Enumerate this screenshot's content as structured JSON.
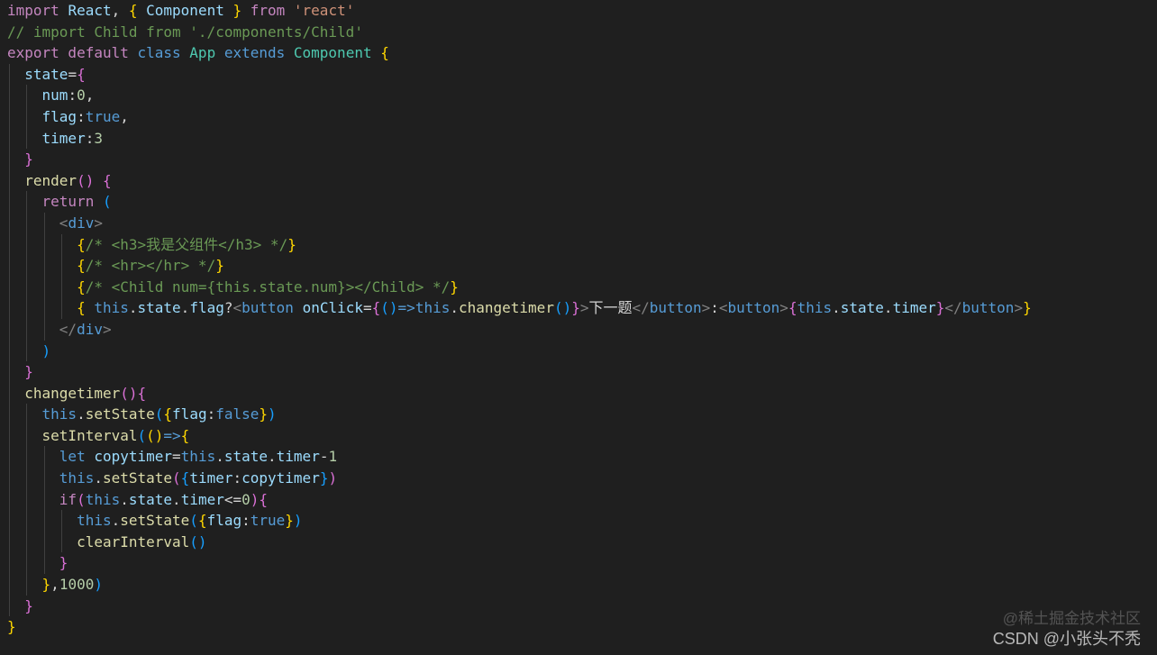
{
  "editor": {
    "background": "#1f1f1f",
    "lines": [
      [
        [
          "kw",
          "import "
        ],
        [
          "id",
          "React"
        ],
        [
          "pn",
          ", "
        ],
        [
          "b1",
          "{ "
        ],
        [
          "id",
          "Component"
        ],
        [
          "b1",
          " }"
        ],
        [
          "kw",
          " from "
        ],
        [
          "str",
          "'react'"
        ]
      ],
      [
        [
          "cm",
          "// import Child from './components/Child'"
        ]
      ],
      [
        [
          "kw",
          "export default "
        ],
        [
          "st",
          "class "
        ],
        [
          "cl",
          "App "
        ],
        [
          "st",
          "extends "
        ],
        [
          "cl",
          "Component "
        ],
        [
          "b1",
          "{"
        ]
      ],
      [
        [
          "id",
          "  state"
        ],
        [
          "pn",
          "="
        ],
        [
          "b2",
          "{"
        ]
      ],
      [
        [
          "id",
          "    num"
        ],
        [
          "pn",
          ":"
        ],
        [
          "num",
          "0"
        ],
        [
          "pn",
          ","
        ]
      ],
      [
        [
          "id",
          "    flag"
        ],
        [
          "pn",
          ":"
        ],
        [
          "st",
          "true"
        ],
        [
          "pn",
          ","
        ]
      ],
      [
        [
          "id",
          "    timer"
        ],
        [
          "pn",
          ":"
        ],
        [
          "num",
          "3"
        ]
      ],
      [
        [
          "b2",
          "  }"
        ]
      ],
      [
        [
          "fn",
          "  render"
        ],
        [
          "b2",
          "()"
        ],
        [
          "pn",
          " "
        ],
        [
          "b2",
          "{"
        ]
      ],
      [
        [
          "kw",
          "    return "
        ],
        [
          "b3",
          "("
        ]
      ],
      [
        [
          "tg",
          "      <"
        ],
        [
          "st",
          "div"
        ],
        [
          "tg",
          ">"
        ]
      ],
      [
        [
          "b1",
          "        {"
        ],
        [
          "cm",
          "/* <h3>我是父组件</h3> */"
        ],
        [
          "b1",
          "}"
        ]
      ],
      [
        [
          "b1",
          "        {"
        ],
        [
          "cm",
          "/* <hr></hr> */"
        ],
        [
          "b1",
          "}"
        ]
      ],
      [
        [
          "b1",
          "        {"
        ],
        [
          "cm",
          "/* <Child num={this.state.num}></Child> */"
        ],
        [
          "b1",
          "}"
        ]
      ],
      [
        [
          "b1",
          "        { "
        ],
        [
          "st",
          "this"
        ],
        [
          "pn",
          "."
        ],
        [
          "id",
          "state"
        ],
        [
          "pn",
          "."
        ],
        [
          "id",
          "flag"
        ],
        [
          "pn",
          "?"
        ],
        [
          "tg",
          "<"
        ],
        [
          "st",
          "button "
        ],
        [
          "id",
          "onClick"
        ],
        [
          "pn",
          "="
        ],
        [
          "b2",
          "{"
        ],
        [
          "b3",
          "()"
        ],
        [
          "st",
          "=>"
        ],
        [
          "st",
          "this"
        ],
        [
          "pn",
          "."
        ],
        [
          "fn",
          "changetimer"
        ],
        [
          "b3",
          "()"
        ],
        [
          "b2",
          "}"
        ],
        [
          "tg",
          ">"
        ],
        [
          "txt",
          "下一题"
        ],
        [
          "tg",
          "</"
        ],
        [
          "st",
          "button"
        ],
        [
          "tg",
          ">"
        ],
        [
          "pn",
          ":"
        ],
        [
          "tg",
          "<"
        ],
        [
          "st",
          "button"
        ],
        [
          "tg",
          ">"
        ],
        [
          "b2",
          "{"
        ],
        [
          "st",
          "this"
        ],
        [
          "pn",
          "."
        ],
        [
          "id",
          "state"
        ],
        [
          "pn",
          "."
        ],
        [
          "id",
          "timer"
        ],
        [
          "b2",
          "}"
        ],
        [
          "tg",
          "</"
        ],
        [
          "st",
          "button"
        ],
        [
          "tg",
          ">"
        ],
        [
          "b1",
          "}"
        ]
      ],
      [
        [
          "tg",
          "      </"
        ],
        [
          "st",
          "div"
        ],
        [
          "tg",
          ">"
        ]
      ],
      [
        [
          "b3",
          "    )"
        ]
      ],
      [
        [
          "b2",
          "  }"
        ]
      ],
      [
        [
          "fn",
          "  changetimer"
        ],
        [
          "b2",
          "(){"
        ]
      ],
      [
        [
          "st",
          "    this"
        ],
        [
          "pn",
          "."
        ],
        [
          "fn",
          "setState"
        ],
        [
          "b3",
          "("
        ],
        [
          "b1",
          "{"
        ],
        [
          "id",
          "flag"
        ],
        [
          "pn",
          ":"
        ],
        [
          "st",
          "false"
        ],
        [
          "b1",
          "}"
        ],
        [
          "b3",
          ")"
        ]
      ],
      [
        [
          "fn",
          "    setInterval"
        ],
        [
          "b3",
          "("
        ],
        [
          "b1",
          "()"
        ],
        [
          "st",
          "=>"
        ],
        [
          "b1",
          "{"
        ]
      ],
      [
        [
          "st",
          "      let "
        ],
        [
          "id",
          "copytimer"
        ],
        [
          "pn",
          "="
        ],
        [
          "st",
          "this"
        ],
        [
          "pn",
          "."
        ],
        [
          "id",
          "state"
        ],
        [
          "pn",
          "."
        ],
        [
          "id",
          "timer"
        ],
        [
          "pn",
          "-"
        ],
        [
          "num",
          "1"
        ]
      ],
      [
        [
          "st",
          "      this"
        ],
        [
          "pn",
          "."
        ],
        [
          "fn",
          "setState"
        ],
        [
          "b2",
          "("
        ],
        [
          "b3",
          "{"
        ],
        [
          "id",
          "timer"
        ],
        [
          "pn",
          ":"
        ],
        [
          "id",
          "copytimer"
        ],
        [
          "b3",
          "}"
        ],
        [
          "b2",
          ")"
        ]
      ],
      [
        [
          "kw",
          "      if"
        ],
        [
          "b2",
          "("
        ],
        [
          "st",
          "this"
        ],
        [
          "pn",
          "."
        ],
        [
          "id",
          "state"
        ],
        [
          "pn",
          "."
        ],
        [
          "id",
          "timer"
        ],
        [
          "pn",
          "<="
        ],
        [
          "num",
          "0"
        ],
        [
          "b2",
          ")"
        ],
        [
          "b2",
          "{"
        ]
      ],
      [
        [
          "st",
          "        this"
        ],
        [
          "pn",
          "."
        ],
        [
          "fn",
          "setState"
        ],
        [
          "b3",
          "("
        ],
        [
          "b1",
          "{"
        ],
        [
          "id",
          "flag"
        ],
        [
          "pn",
          ":"
        ],
        [
          "st",
          "true"
        ],
        [
          "b1",
          "}"
        ],
        [
          "b3",
          ")"
        ]
      ],
      [
        [
          "fn",
          "        clearInterval"
        ],
        [
          "b3",
          "()"
        ]
      ],
      [
        [
          "b2",
          "      }"
        ]
      ],
      [
        [
          "b1",
          "    }"
        ],
        [
          "pn",
          ","
        ],
        [
          "num",
          "1000"
        ],
        [
          "b3",
          ")"
        ]
      ],
      [
        [
          "b2",
          "  }"
        ]
      ],
      [
        [
          "b1",
          "}"
        ]
      ]
    ]
  },
  "watermark": {
    "top": "@稀土掘金技术社区",
    "bottom": "CSDN @小张头不秃"
  }
}
